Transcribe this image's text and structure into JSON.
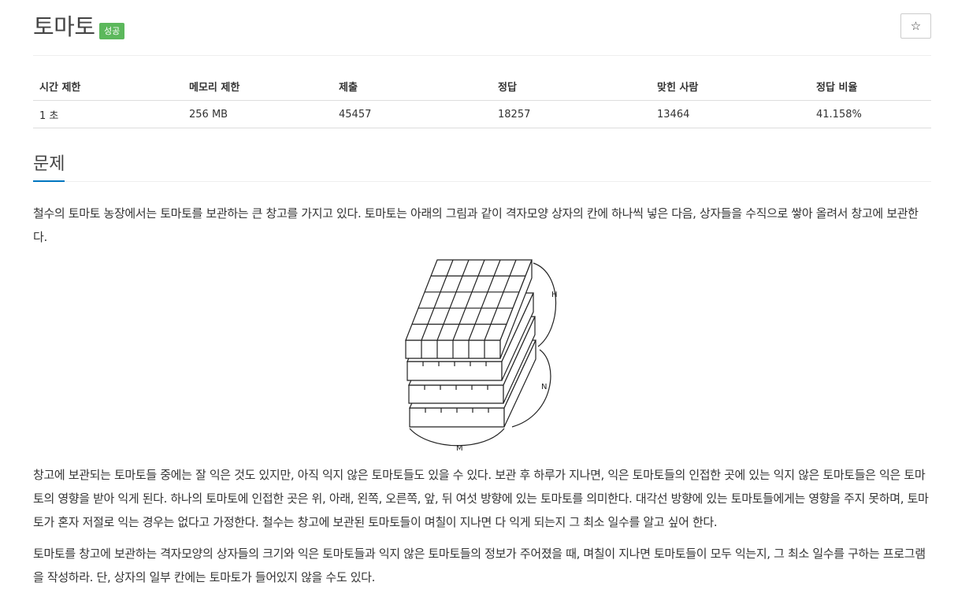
{
  "problem": {
    "title": "토마토",
    "status_badge": "성공",
    "star_icon": "☆"
  },
  "info_table": {
    "headers": [
      "시간 제한",
      "메모리 제한",
      "제출",
      "정답",
      "맞힌 사람",
      "정답 비율"
    ],
    "values": [
      "1 초",
      "256 MB",
      "45457",
      "18257",
      "13464",
      "41.158%"
    ]
  },
  "section": {
    "title": "문제"
  },
  "description": {
    "p1": "철수의 토마토 농장에서는 토마토를 보관하는 큰 창고를 가지고 있다. 토마토는 아래의 그림과 같이 격자모양 상자의 칸에 하나씩 넣은 다음, 상자들을 수직으로 쌓아 올려서 창고에 보관한다.",
    "p2": "창고에 보관되는 토마토들 중에는 잘 익은 것도 있지만, 아직 익지 않은 토마토들도 있을 수 있다. 보관 후 하루가 지나면, 익은 토마토들의 인접한 곳에 있는 익지 않은 토마토들은 익은 토마토의 영향을 받아 익게 된다. 하나의 토마토에 인접한 곳은 위, 아래, 왼쪽, 오른쪽, 앞, 뒤 여섯 방향에 있는 토마토를 의미한다. 대각선 방향에 있는 토마토들에게는 영향을 주지 못하며, 토마토가 혼자 저절로 익는 경우는 없다고 가정한다. 철수는 창고에 보관된 토마토들이 며칠이 지나면 다 익게 되는지 그 최소 일수를 알고 싶어 한다.",
    "p3": "토마토를 창고에 보관하는 격자모양의 상자들의 크기와 익은 토마토들과 익지 않은 토마토들의 정보가 주어졌을 때, 며칠이 지나면 토마토들이 모두 익는지, 그 최소 일수를 구하는 프로그램을 작성하라. 단, 상자의 일부 칸에는 토마토가 들어있지 않을 수도 있다."
  },
  "figure": {
    "label_h": "H",
    "label_n": "N",
    "label_m": "M"
  },
  "colors": {
    "badge": "#5cb85c",
    "accent": "#0076c0"
  }
}
